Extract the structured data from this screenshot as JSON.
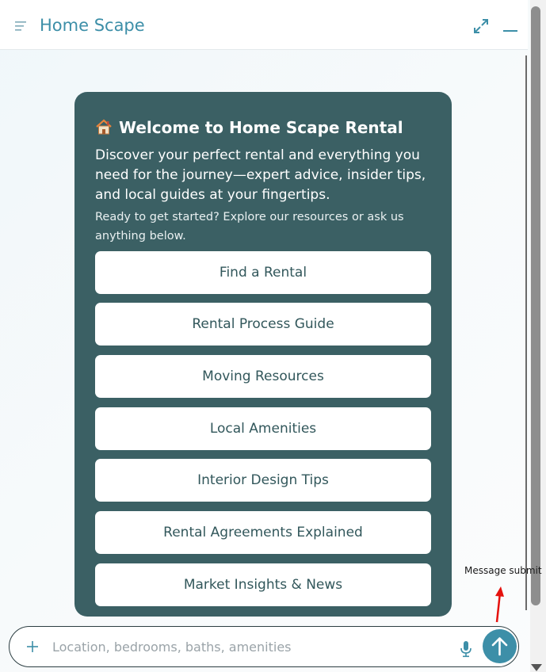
{
  "header": {
    "title": "Home Scape"
  },
  "welcome": {
    "title": "Welcome to Home Scape Rental",
    "description": "Discover your perfect rental and everything you need for the journey—expert advice, insider tips, and local guides at your fingertips.",
    "subtext": "Ready to get started? Explore our resources or ask us anything below.",
    "options": [
      "Find a Rental",
      "Rental Process Guide",
      "Moving Resources",
      "Local Amenities",
      "Interior Design Tips",
      "Rental Agreements Explained",
      "Market Insights & News"
    ]
  },
  "input": {
    "placeholder": "Location, bedrooms, baths, amenities"
  },
  "tooltip": {
    "text": "Message submit"
  },
  "colors": {
    "accent": "#3d8fa8",
    "card": "#3b6064",
    "button_text": "#32575b"
  },
  "icons": {
    "menu": "menu-icon",
    "expand": "expand-icon",
    "minimize": "minimize-icon",
    "house": "house-icon",
    "plus": "plus-icon",
    "mic": "microphone-icon",
    "send": "arrow-up-icon"
  }
}
